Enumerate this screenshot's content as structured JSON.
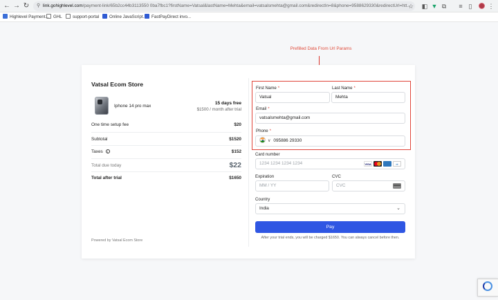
{
  "browser": {
    "url_host": "link.gohighlevel.com",
    "url_rest": "/payment-link/65b2cc44b3113550 0ba7fbc1?firstName=Vatsal&lastName=Mehta&email=vatsalsmehta@gmail.com&redirectIn=8&phone=9588629330&redirectUrl=htt...",
    "bookmarks": [
      {
        "label": "Highlevel Payment...",
        "icon": "doc-icon",
        "color": "#3b6fd8"
      },
      {
        "label": "GHL",
        "icon": "folder-icon",
        "color": "#777777"
      },
      {
        "label": "support-portal",
        "icon": "folder-icon",
        "color": "#777777"
      },
      {
        "label": "Online JavaScript...",
        "icon": "js-icon",
        "color": "#2f5bd3"
      },
      {
        "label": "FastPayDirect invo...",
        "icon": "doc-icon",
        "color": "#2f5bd3"
      }
    ]
  },
  "annotation": {
    "text": "Prefilled Data From Url Params",
    "color": "#e0453a"
  },
  "summary": {
    "store_name": "Vatsal Ecom Store",
    "product_name": "Iphone 14 pro max",
    "trial_title": "15 days free",
    "trial_subtitle": "$1500 / month after trial",
    "setup_fee_label": "One time setup fee",
    "setup_fee_value": "$20",
    "subtotal_label": "Subtotal",
    "subtotal_value": "$1520",
    "taxes_label": "Taxes",
    "taxes_value": "$152",
    "total_due_label": "Total due today",
    "total_due_value": "$22",
    "total_after_label": "Total after trial",
    "total_after_value": "$1650",
    "powered_by": "Powered by Vatsal Ecom Store"
  },
  "form": {
    "first_name_label": "First Name",
    "first_name_value": "Vatsal",
    "last_name_label": "Last Name",
    "last_name_value": "Mehta",
    "email_label": "Email",
    "email_value": "vatsalsmehta@gmail.com",
    "phone_label": "Phone",
    "phone_value": "095886 29330",
    "required_mark": "*",
    "card_number_label": "Card number",
    "card_number_placeholder": "1234 1234 1234 1234",
    "card_brands": [
      "VISA",
      "MC",
      "AMEX",
      "DISC"
    ],
    "expiration_label": "Expiration",
    "expiration_placeholder": "MM / YY",
    "cvc_label": "CVC",
    "cvc_placeholder": "CVC",
    "country_label": "Country",
    "country_value": "India",
    "pay_button": "Pay",
    "trial_note": "After your trial ends, you will be charged $1650. You can always cancel before then."
  },
  "colors": {
    "accent": "#2f56e3",
    "highlight": "#e0453a"
  }
}
